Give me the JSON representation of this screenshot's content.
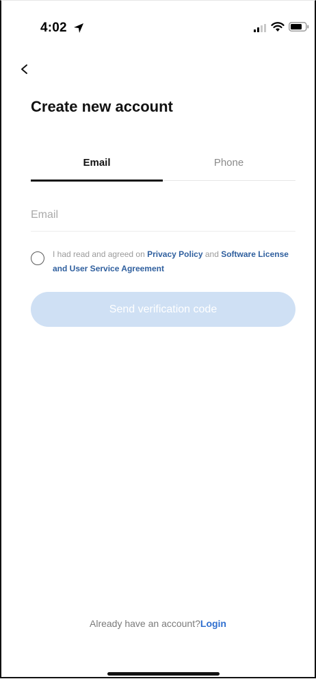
{
  "status_bar": {
    "time": "4:02",
    "icons": [
      "location-arrow-icon",
      "cellular-signal-icon",
      "wifi-icon",
      "battery-icon"
    ]
  },
  "header": {
    "back_icon": "chevron-left-icon",
    "title": "Create new account"
  },
  "tabs": [
    {
      "label": "Email",
      "selected": true
    },
    {
      "label": "Phone",
      "selected": false
    }
  ],
  "form": {
    "email_placeholder": "Email",
    "email_value": ""
  },
  "agreement": {
    "checked": false,
    "prefix": "I had read and agreed on ",
    "privacy_link": "Privacy Policy",
    "middle": " and ",
    "license_link": "Software License and User Service Agreement"
  },
  "send_button": {
    "label": "Send verification code",
    "enabled": false
  },
  "footer": {
    "prompt": "Already have an account?",
    "login_link": "Login"
  },
  "colors": {
    "accent_link": "#2f6fcf",
    "policy_link": "#2f5f9e",
    "button_disabled": "#cfe0f4"
  }
}
